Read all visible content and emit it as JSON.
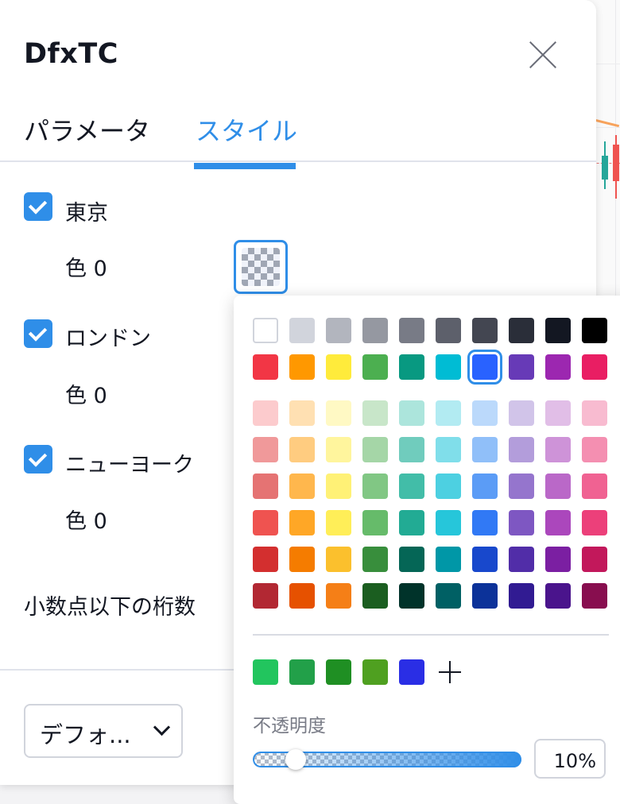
{
  "dialog": {
    "title": "DfxTC",
    "close_icon": "close-icon"
  },
  "tabs": [
    {
      "label": "パラメータ",
      "active": false
    },
    {
      "label": "スタイル",
      "active": true
    }
  ],
  "style": {
    "sessions": [
      {
        "label": "東京",
        "checked": true,
        "color_label": "色 0"
      },
      {
        "label": "ロンドン",
        "checked": true,
        "color_label": "色 0"
      },
      {
        "label": "ニューヨーク",
        "checked": true,
        "color_label": "色 0"
      }
    ],
    "precision_label": "小数点以下の桁数",
    "precision_value": "デフォ..."
  },
  "color_picker": {
    "accent": "#2f8ee8",
    "base_rows": [
      [
        "#ffffff",
        "#d1d4dc",
        "#b2b5be",
        "#9598a1",
        "#787b86",
        "#5d606b",
        "#434651",
        "#2a2e39",
        "#131722",
        "#000000"
      ],
      [
        "#f23645",
        "#ff9800",
        "#ffeb3b",
        "#4caf50",
        "#089981",
        "#00bcd4",
        "#2962ff",
        "#673ab7",
        "#9c27b0",
        "#e91e63"
      ]
    ],
    "selected": "#2962ff",
    "shade_rows": [
      [
        "#fccbcd",
        "#ffe0b2",
        "#fff9c4",
        "#c8e6c9",
        "#ace5dc",
        "#b2ebf2",
        "#bbd9fb",
        "#d1c4e9",
        "#e1bee7",
        "#f8bbd0"
      ],
      [
        "#f0999a",
        "#ffcc80",
        "#fff59d",
        "#a5d6a7",
        "#70ccbd",
        "#80deea",
        "#90bff9",
        "#b39ddb",
        "#ce93d8",
        "#f48fb1"
      ],
      [
        "#e57373",
        "#ffb74d",
        "#fff176",
        "#81c784",
        "#42bda8",
        "#4dd0e1",
        "#5b9cf6",
        "#9575cd",
        "#ba68c8",
        "#f06292"
      ],
      [
        "#ef5350",
        "#ffa726",
        "#ffee58",
        "#66bb6a",
        "#22ab94",
        "#26c6da",
        "#3179f5",
        "#7e57c2",
        "#ab47bc",
        "#ec407a"
      ],
      [
        "#d32f2f",
        "#f57c00",
        "#fbc02d",
        "#388e3c",
        "#056656",
        "#0097a7",
        "#1848cc",
        "#512da8",
        "#7b1fa2",
        "#c2185b"
      ],
      [
        "#b22833",
        "#e65100",
        "#f57f17",
        "#1b5e20",
        "#00332a",
        "#006064",
        "#0c3299",
        "#311b92",
        "#4a148c",
        "#880e4f"
      ]
    ],
    "custom": [
      "#22c55e",
      "#22a049",
      "#1f8f23",
      "#4fa020",
      "#2a2ee5"
    ],
    "add_icon": "plus-icon",
    "opacity_label": "不透明度",
    "opacity_value": "10%",
    "opacity_fraction": 0.1
  }
}
